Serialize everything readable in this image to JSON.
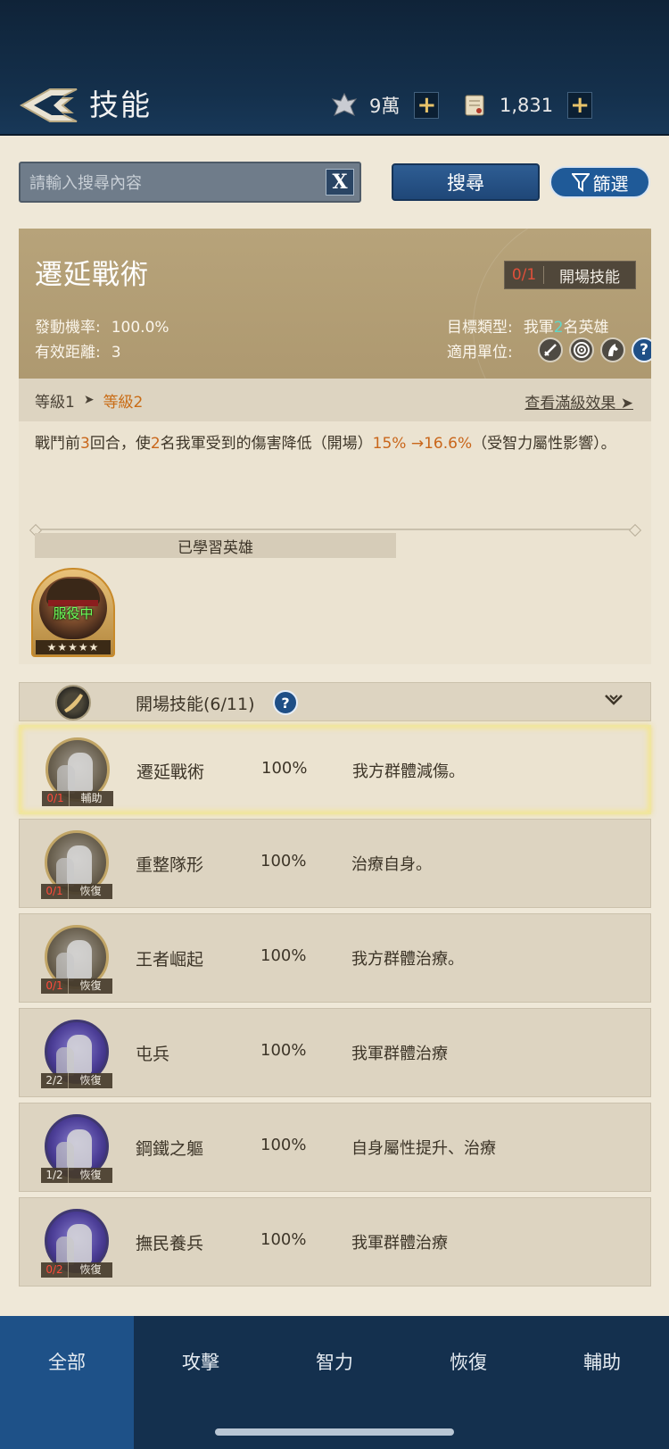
{
  "header": {
    "title": "技能",
    "resources": [
      {
        "icon": "crest-icon",
        "value": "9萬",
        "plus": "+"
      },
      {
        "icon": "scroll-icon",
        "value": "1,831",
        "plus": "+"
      }
    ]
  },
  "search": {
    "placeholder": "請輸入搜尋內容",
    "value": "",
    "clear_label": "X",
    "search_label": "搜尋",
    "filter_label": "篩選"
  },
  "detail": {
    "name": "遷延戰術",
    "tag_count": "0/1",
    "tag_label": "開場技能",
    "trigger_rate_label": "發動機率:",
    "trigger_rate": "100.0%",
    "range_label": "有效距離:",
    "range": "3",
    "target_label": "目標類型:",
    "target_prefix": "我軍",
    "target_count": "2",
    "target_suffix": "名英雄",
    "units_label": "適用單位:",
    "units": [
      "sword-icon",
      "target-icon",
      "horse-icon",
      "help-icon"
    ],
    "level_from": "等級1",
    "level_to": "等級2",
    "view_full": "查看滿級效果",
    "desc_parts": {
      "p1": "戰鬥前",
      "n1": "3",
      "p2": "回合，使",
      "n2": "2",
      "p3": "名我軍受到的傷害降低（開場）",
      "v1": "15%",
      "arrow": " →",
      "v2": "16.6%",
      "p4": "（受智力屬性影響）。"
    },
    "learned_label": "已學習英雄",
    "hero": {
      "status": "服役中",
      "stars": "★★★★★"
    }
  },
  "category": {
    "title": "開場技能(6/11)",
    "help": "?",
    "toggle": "⌄"
  },
  "skills": [
    {
      "name": "遷延戰術",
      "rate": "100%",
      "desc": "我方群體減傷。",
      "count": "0/1",
      "count_red": true,
      "cat": "輔助",
      "style": "gold",
      "selected": true
    },
    {
      "name": "重整隊形",
      "rate": "100%",
      "desc": "治療自身。",
      "count": "0/1",
      "count_red": true,
      "cat": "恢復",
      "style": "gold",
      "selected": false
    },
    {
      "name": "王者崛起",
      "rate": "100%",
      "desc": "我方群體治療。",
      "count": "0/1",
      "count_red": true,
      "cat": "恢復",
      "style": "gold",
      "selected": false
    },
    {
      "name": "屯兵",
      "rate": "100%",
      "desc": "我軍群體治療",
      "count": "2/2",
      "count_red": false,
      "cat": "恢復",
      "style": "blue",
      "selected": false
    },
    {
      "name": "鋼鐵之軀",
      "rate": "100%",
      "desc": "自身屬性提升、治療",
      "count": "1/2",
      "count_red": false,
      "cat": "恢復",
      "style": "blue",
      "selected": false
    },
    {
      "name": "撫民養兵",
      "rate": "100%",
      "desc": "我軍群體治療",
      "count": "0/2",
      "count_red": true,
      "cat": "恢復",
      "style": "blue",
      "selected": false
    }
  ],
  "tabs": [
    {
      "label": "全部",
      "active": true
    },
    {
      "label": "攻擊",
      "active": false
    },
    {
      "label": "智力",
      "active": false
    },
    {
      "label": "恢復",
      "active": false
    },
    {
      "label": "輔助",
      "active": false
    }
  ],
  "colors": {
    "header_bg": "#14304c",
    "panel_gold": "#b7a37a",
    "accent_orange": "#c9661a",
    "tab_active": "#1e5188"
  }
}
